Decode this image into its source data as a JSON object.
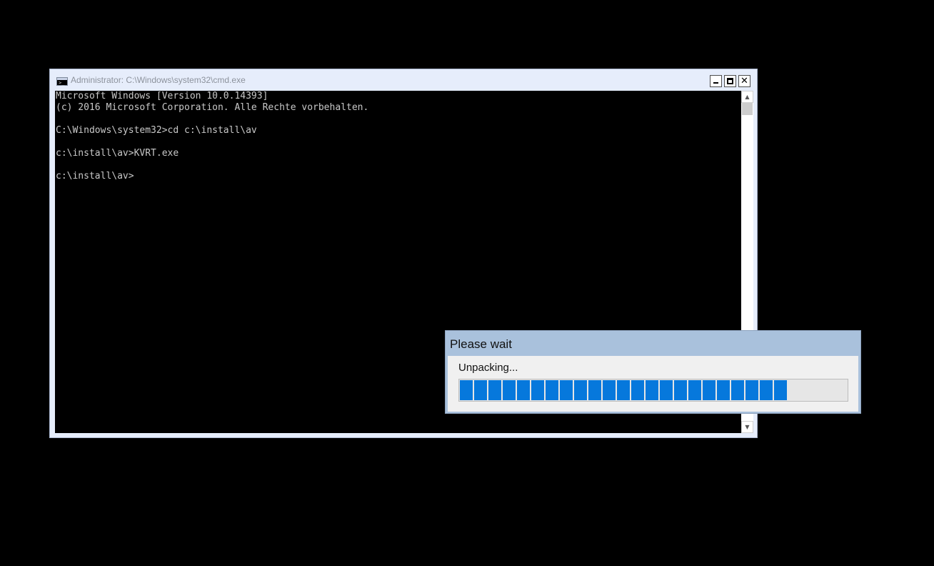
{
  "cmd_window": {
    "title": "Administrator: C:\\Windows\\system32\\cmd.exe",
    "icon": "console-icon",
    "output_lines": [
      "Microsoft Windows [Version 10.0.14393]",
      "(c) 2016 Microsoft Corporation. Alle Rechte vorbehalten.",
      "",
      "C:\\Windows\\system32>cd c:\\install\\av",
      "",
      "c:\\install\\av>KVRT.exe",
      "",
      "c:\\install\\av>"
    ],
    "buttons": {
      "minimize_icon": "minimize-icon",
      "maximize_icon": "maximize-icon",
      "close_icon": "close-icon"
    }
  },
  "wait_dialog": {
    "title": "Please wait",
    "status": "Unpacking...",
    "progress": {
      "filled_segments": 23,
      "total_segments": 27,
      "color": "#0678dc"
    }
  },
  "colors": {
    "desktop": "#000000",
    "cmd_frame": "#e6edfb",
    "dialog_title_bar": "#a9c1dc",
    "progress_fill": "#0678dc"
  }
}
